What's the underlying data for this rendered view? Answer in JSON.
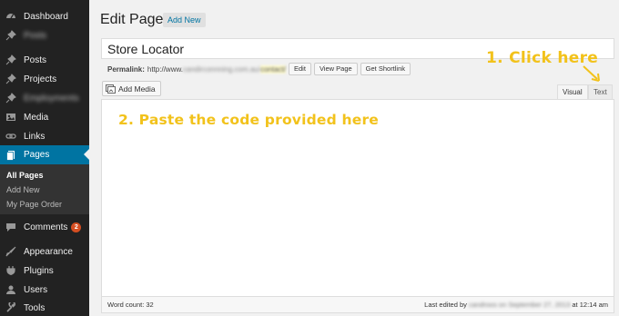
{
  "sidebar": {
    "items": [
      {
        "label": "Dashboard",
        "icon": "dashboard-icon",
        "blurred": false
      },
      {
        "label": "Posts",
        "icon": "pin-icon",
        "blurred": true
      },
      {
        "label": "Posts",
        "icon": "pin-icon",
        "blurred": false
      },
      {
        "label": "Projects",
        "icon": "pin-icon",
        "blurred": false
      },
      {
        "label": "Employments",
        "icon": "pin-icon",
        "blurred": true
      },
      {
        "label": "Media",
        "icon": "media-icon",
        "blurred": false
      },
      {
        "label": "Links",
        "icon": "link-icon",
        "blurred": false
      },
      {
        "label": "Pages",
        "icon": "page-icon",
        "blurred": false
      },
      {
        "label": "Comments",
        "icon": "comment-icon",
        "blurred": false,
        "badge": "2"
      },
      {
        "label": "Appearance",
        "icon": "brush-icon",
        "blurred": false
      },
      {
        "label": "Plugins",
        "icon": "plug-icon",
        "blurred": false
      },
      {
        "label": "Users",
        "icon": "user-icon",
        "blurred": false
      },
      {
        "label": "Tools",
        "icon": "wrench-icon",
        "blurred": false
      }
    ],
    "submenu": [
      "All Pages",
      "Add New",
      "My Page Order"
    ]
  },
  "header": {
    "title": "Edit Page",
    "add_new_label": "Add New"
  },
  "editor": {
    "page_title_value": "Store Locator",
    "permalink_label": "Permalink:",
    "permalink_url": "http://www.",
    "permalink_url_blurred": "candirconnning.com.au/",
    "permalink_slug": "contact/",
    "edit_label": "Edit",
    "view_page_label": "View Page",
    "get_shortlink_label": "Get Shortlink",
    "add_media_label": "Add Media",
    "tab_visual": "Visual",
    "tab_text": "Text",
    "word_count": "Word count: 32",
    "last_edited_prefix": "Last edited by",
    "last_edited_blurred": "candroos on September 27, 2013",
    "last_edited_time": "at 12:14 am"
  },
  "annotations": {
    "click_here": "1. Click here",
    "paste_code": "2. Paste the code provided here",
    "color": "#f2c21b"
  },
  "colors": {
    "sidebar_bg": "#222222",
    "active_bg": "#0074a2",
    "badge_bg": "#d54e21"
  }
}
